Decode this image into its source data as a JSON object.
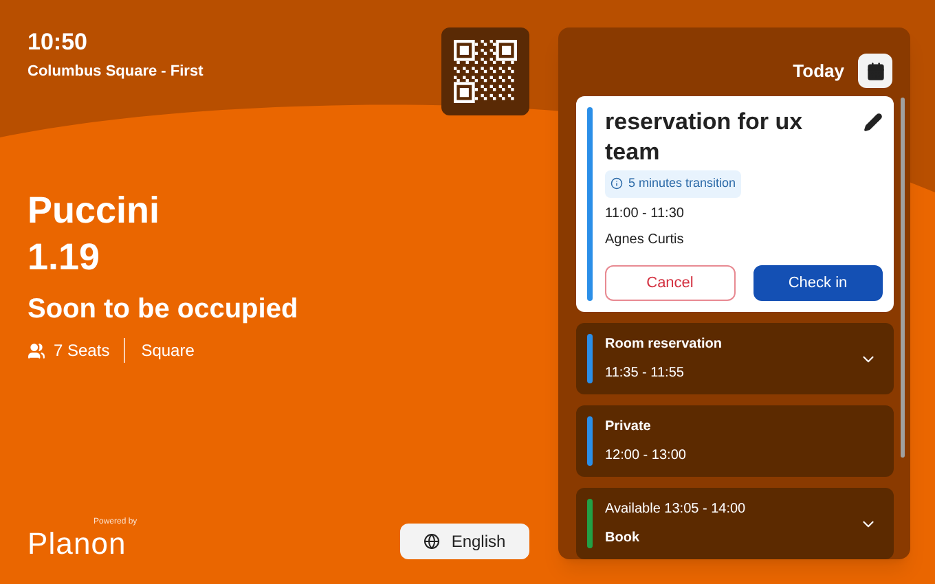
{
  "header": {
    "time": "10:50",
    "location": "Columbus Square - First"
  },
  "room": {
    "name": "Puccini",
    "number": "1.19",
    "status": "Soon to be occupied",
    "seats": "7 Seats",
    "layout": "Square"
  },
  "branding": {
    "powered_by": "Powered by",
    "logo": "Planon"
  },
  "language_button": {
    "label": "English"
  },
  "agenda": {
    "title": "Today",
    "current": {
      "title": "reservation for ux team",
      "transition": "5 minutes transition",
      "time": "11:00 - 11:30",
      "organizer": "Agnes Curtis",
      "color": "#2b8fe8",
      "buttons": [
        {
          "label": "Cancel",
          "kind": "outline"
        },
        {
          "label": "Check in",
          "kind": "primary"
        }
      ]
    },
    "items": [
      {
        "kind": "booking",
        "title": "Room reservation",
        "time": "11:35 - 11:55",
        "color": "#2b8fe8",
        "expandable": true
      },
      {
        "kind": "booking",
        "title": "Private",
        "time": "12:00 - 13:00",
        "color": "#2b8fe8",
        "expandable": false
      },
      {
        "kind": "available",
        "title": "Available 13:05 - 14:00",
        "action": "Book",
        "color": "#22a045",
        "expandable": true
      }
    ]
  }
}
